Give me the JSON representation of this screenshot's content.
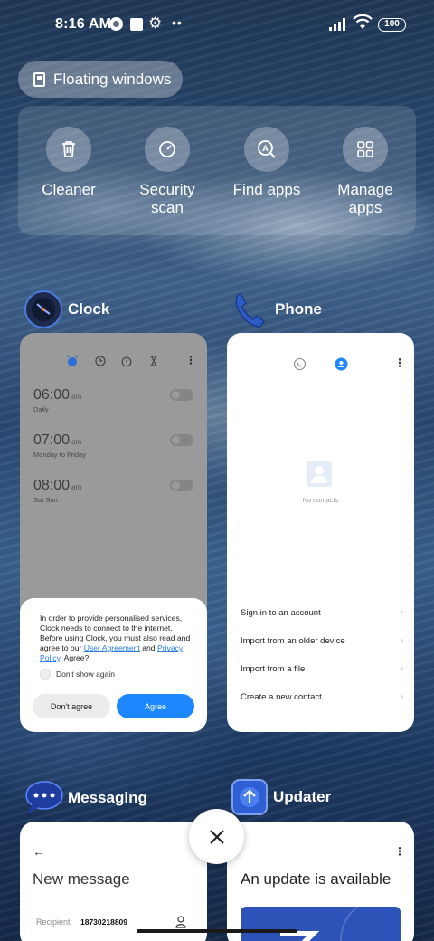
{
  "status_bar": {
    "time": "8:16 AM",
    "battery": "100"
  },
  "floating_windows": {
    "label": "Floating windows"
  },
  "tools": [
    {
      "label": "Cleaner",
      "icon": "trash-icon"
    },
    {
      "label": "Security\nscan",
      "icon": "shield-check-icon"
    },
    {
      "label": "Find apps",
      "icon": "search-app-icon"
    },
    {
      "label": "Manage\napps",
      "icon": "grid-icon"
    }
  ],
  "clock": {
    "title": "Clock",
    "alarms": [
      {
        "time": "06:00",
        "ampm": "am",
        "repeat": "Daily"
      },
      {
        "time": "07:00",
        "ampm": "am",
        "repeat": "Monday to Friday"
      },
      {
        "time": "08:00",
        "ampm": "am",
        "repeat": "Sat Sun"
      }
    ],
    "dialog": {
      "text_pre": "In order to provide personalised services, Clock needs to connect to the internet. Before using Clock, you must also read and agree to our ",
      "link1": "User Agreement",
      "text_mid": " and ",
      "link2": "Privacy Policy",
      "text_post": ". Agree?",
      "dont_show": "Don't show again",
      "disagree": "Don't agree",
      "agree": "Agree"
    }
  },
  "phone": {
    "title": "Phone",
    "empty": "No contacts",
    "actions": [
      "Sign in to an account",
      "Import from an older device",
      "Import from a file",
      "Create a new contact"
    ]
  },
  "messaging": {
    "title": "Messaging",
    "heading": "New message",
    "recipient_label": "Recipient:",
    "recipient_value": "18730218809"
  },
  "updater": {
    "title": "Updater",
    "heading": "An update is available"
  },
  "colors": {
    "accent": "#1d87ff",
    "link": "#2a7de1"
  }
}
